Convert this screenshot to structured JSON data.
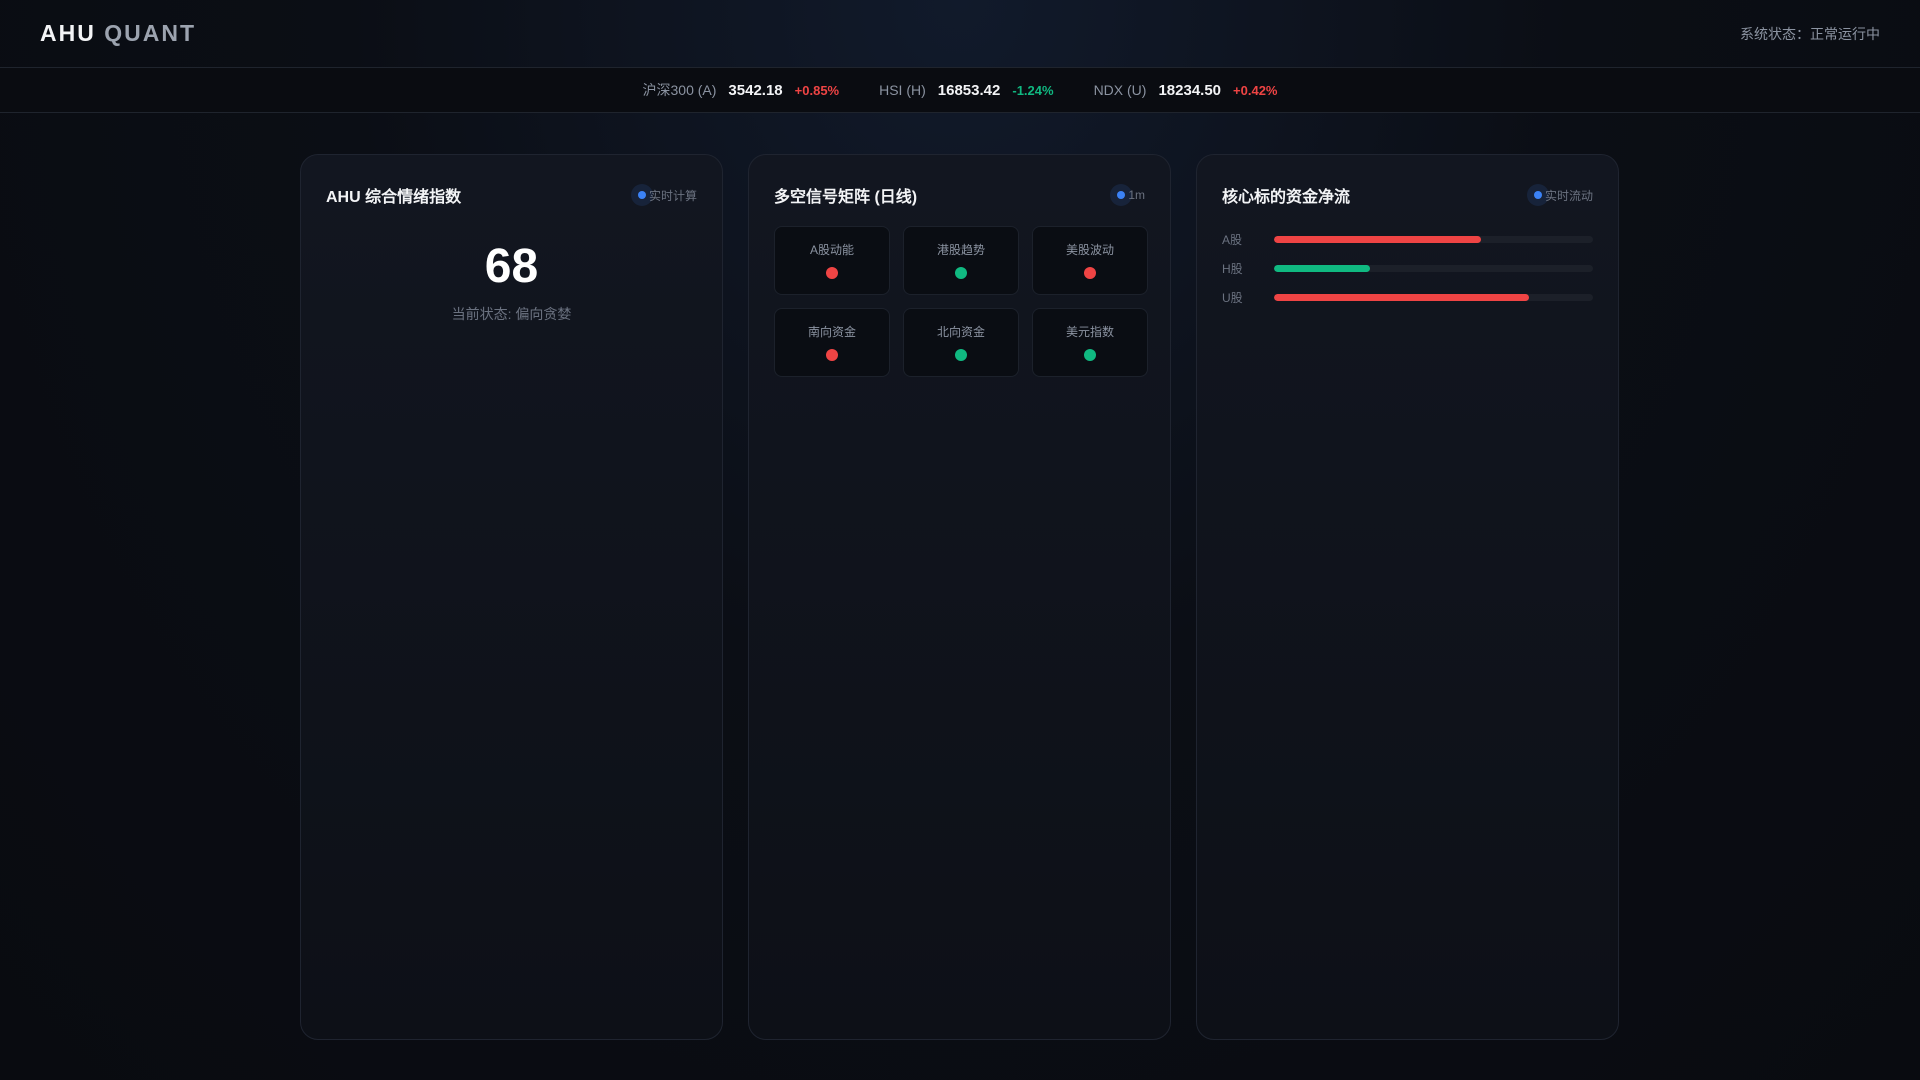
{
  "header": {
    "logo_a": "AHU",
    "logo_b": "QUANT",
    "status": "系统状态：正常运行中"
  },
  "ticker": [
    {
      "name": "沪深300 (A)",
      "value": "3542.18",
      "change": "+0.85%",
      "dir": "up"
    },
    {
      "name": "HSI (H)",
      "value": "16853.42",
      "change": "-1.24%",
      "dir": "down"
    },
    {
      "name": "NDX (U)",
      "value": "18234.50",
      "change": "+0.42%",
      "dir": "up"
    }
  ],
  "colors": {
    "up": "#ef4444",
    "down": "#10b981",
    "accent": "#3b82f6"
  },
  "sentiment": {
    "title": "AHU 综合情绪指数",
    "badge": "实时计算",
    "score": "68",
    "state": "当前状态: 偏向贪婪"
  },
  "signals": {
    "title": "多空信号矩阵 (日线)",
    "badge": "1m",
    "items": [
      {
        "label": "A股动能",
        "signal": "up"
      },
      {
        "label": "港股趋势",
        "signal": "down"
      },
      {
        "label": "美股波动",
        "signal": "up"
      },
      {
        "label": "南向资金",
        "signal": "up"
      },
      {
        "label": "北向资金",
        "signal": "down"
      },
      {
        "label": "美元指数",
        "signal": "down"
      }
    ]
  },
  "flows": {
    "title": "核心标的资金净流",
    "badge": "实时流动",
    "items": [
      {
        "label": "A股",
        "percent": 65,
        "dir": "up"
      },
      {
        "label": "H股",
        "percent": 30,
        "dir": "down"
      },
      {
        "label": "U股",
        "percent": 80,
        "dir": "up"
      }
    ]
  }
}
